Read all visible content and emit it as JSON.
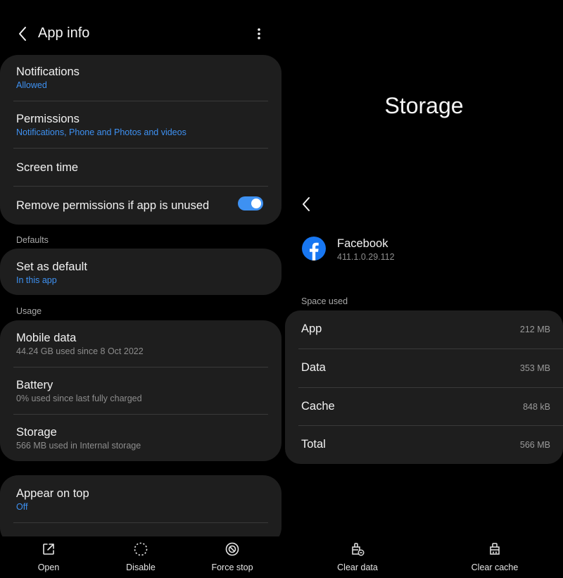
{
  "app_info": {
    "title": "App info",
    "notifications": {
      "title": "Notifications",
      "sub": "Allowed"
    },
    "permissions": {
      "title": "Permissions",
      "sub": "Notifications, Phone and Photos and videos"
    },
    "screen_time": {
      "title": "Screen time"
    },
    "remove_permissions": {
      "title": "Remove permissions if app is unused",
      "enabled": true
    },
    "defaults_header": "Defaults",
    "set_as_default": {
      "title": "Set as default",
      "sub": "In this app"
    },
    "usage_header": "Usage",
    "mobile_data": {
      "title": "Mobile data",
      "sub": "44.24 GB used since 8 Oct 2022"
    },
    "battery": {
      "title": "Battery",
      "sub": "0% used since last fully charged"
    },
    "storage": {
      "title": "Storage",
      "sub": "566 MB used in Internal storage"
    },
    "appear_on_top": {
      "title": "Appear on top",
      "sub": "Off"
    },
    "bottom": {
      "open": "Open",
      "disable": "Disable",
      "force_stop": "Force stop"
    },
    "accent_color": "#3e91f2"
  },
  "storage": {
    "big_title": "Storage",
    "app_name": "Facebook",
    "app_version": "411.1.0.29.112",
    "section": "Space used",
    "rows": [
      {
        "key": "App",
        "value": "212 MB"
      },
      {
        "key": "Data",
        "value": "353 MB"
      },
      {
        "key": "Cache",
        "value": "848 kB"
      },
      {
        "key": "Total",
        "value": "566 MB"
      }
    ],
    "bottom": {
      "clear_data": "Clear data",
      "clear_cache": "Clear cache"
    }
  }
}
